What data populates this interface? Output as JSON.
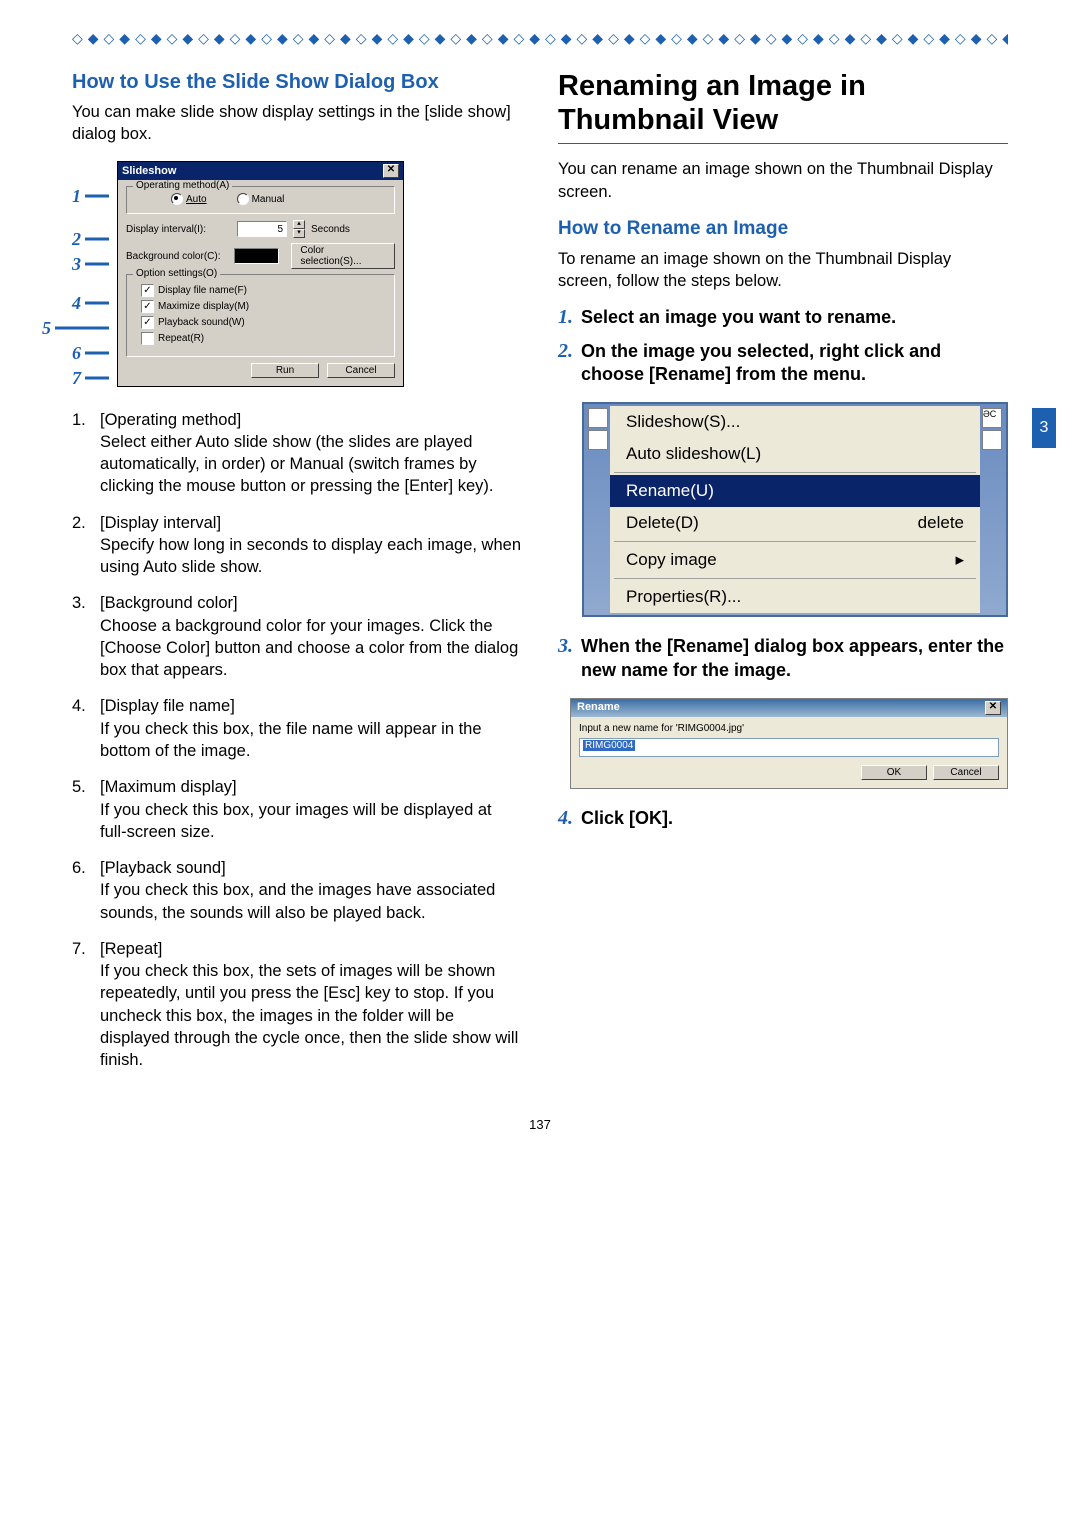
{
  "page_number": "137",
  "chapter_tab": "3",
  "left": {
    "heading": "How to Use the Slide Show Dialog Box",
    "intro": "You can make slide show display settings in the [slide show] dialog box.",
    "callouts": [
      "1",
      "2",
      "3",
      "4",
      "5",
      "6",
      "7"
    ],
    "dlg": {
      "title": "Slideshow",
      "grp1_legend": "Operating method(A)",
      "auto": "Auto",
      "manual": "Manual",
      "interval_lbl": "Display interval(I):",
      "interval_val": "5",
      "seconds": "Seconds",
      "bg_lbl": "Background color(C):",
      "color_btn": "Color selection(S)...",
      "grp2_legend": "Option settings(O)",
      "opt1": "Display file name(F)",
      "opt2": "Maximize display(M)",
      "opt3": "Playback sound(W)",
      "opt4": "Repeat(R)",
      "run": "Run",
      "cancel": "Cancel"
    },
    "items": [
      {
        "n": "1.",
        "title": "[Operating method]",
        "body": "Select either Auto slide show (the slides are played automatically, in order) or Manual (switch frames by clicking the mouse button or pressing the [Enter] key)."
      },
      {
        "n": "2.",
        "title": "[Display interval]",
        "body": "Specify how long in seconds to display each image, when using Auto slide show."
      },
      {
        "n": "3.",
        "title": "[Background color]",
        "body": "Choose a background color for your images. Click the [Choose Color] button and choose a color from the dialog box that appears."
      },
      {
        "n": "4.",
        "title": "[Display file name]",
        "body": "If you check this box, the file name will appear in the bottom of the image."
      },
      {
        "n": "5.",
        "title": "[Maximum display]",
        "body": "If you check this box, your images will be displayed at full-screen size."
      },
      {
        "n": "6.",
        "title": "[Playback sound]",
        "body": "If you check this box, and the images have associated sounds, the sounds will also be played back."
      },
      {
        "n": "7.",
        "title": "[Repeat]",
        "body": "If you check this box, the sets of images will be shown repeatedly, until you press the [Esc] key to stop. If you uncheck this box, the images in the folder will be displayed through the cycle once, then the slide show will finish."
      }
    ]
  },
  "right": {
    "heading": "Renaming an Image in Thumbnail View",
    "intro": "You can rename an image shown on the Thumbnail Display screen.",
    "sub": "How to Rename an Image",
    "sub_intro": "To rename an image shown on the Thumbnail Display screen, follow the steps below.",
    "steps": [
      {
        "n": "1.",
        "t": "Select an image you want to rename."
      },
      {
        "n": "2.",
        "t": "On the image you selected, right click and choose [Rename] from the menu."
      }
    ],
    "ctx": {
      "slideshow": "Slideshow(S)...",
      "auto": "Auto slideshow(L)",
      "rename": "Rename(U)",
      "delete": "Delete(D)",
      "delete_key": "delete",
      "copy": "Copy image",
      "props": "Properties(R)..."
    },
    "steps2": [
      {
        "n": "3.",
        "t": "When the [Rename] dialog box appears, enter the new name for the image."
      }
    ],
    "ren": {
      "title": "Rename",
      "prompt": "Input a new name for 'RIMG0004.jpg'",
      "value": "RIMG0004",
      "ok": "OK",
      "cancel": "Cancel"
    },
    "steps3": [
      {
        "n": "4.",
        "t": "Click [OK]."
      }
    ]
  }
}
